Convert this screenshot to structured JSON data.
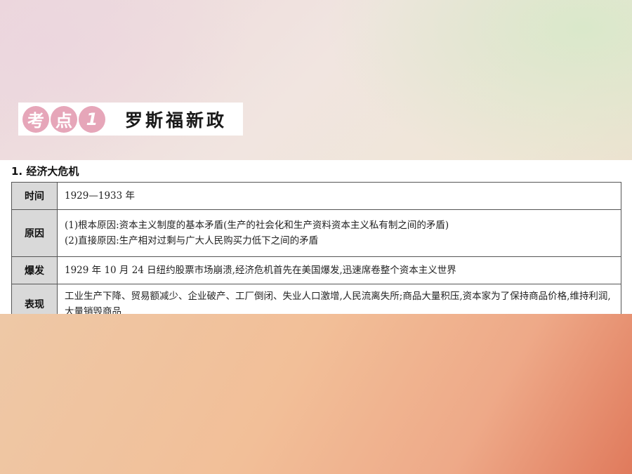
{
  "heading": {
    "kao": "考",
    "dian": "点",
    "number": "1",
    "title": "罗斯福新政"
  },
  "section": {
    "title": "1. 经济大危机"
  },
  "table": {
    "rows": [
      {
        "label": "时间",
        "lines": [
          "1929—1933 年"
        ]
      },
      {
        "label": "原因",
        "lines": [
          "(1)根本原因:资本主义制度的基本矛盾(生产的社会化和生产资料资本主义私有制之间的矛盾)",
          "(2)直接原因:生产相对过剩与广大人民购买力低下之间的矛盾"
        ]
      },
      {
        "label": "爆发",
        "lines": [
          "1929 年 10 月 24 日纽约股票市场崩溃,经济危机首先在美国爆发,迅速席卷整个资本主义世界"
        ]
      },
      {
        "label": "表现",
        "lines": [
          "工业生产下降、贸易额减少、企业破产、工厂倒闭、失业人口激增,人民流离失所;商品大量积压,资本家为了保持商品价格,维持利润,大量销毁商品"
        ]
      }
    ]
  },
  "colors": {
    "accent_pink": "#e6a6b9",
    "label_gray": "#d9d9d9"
  }
}
